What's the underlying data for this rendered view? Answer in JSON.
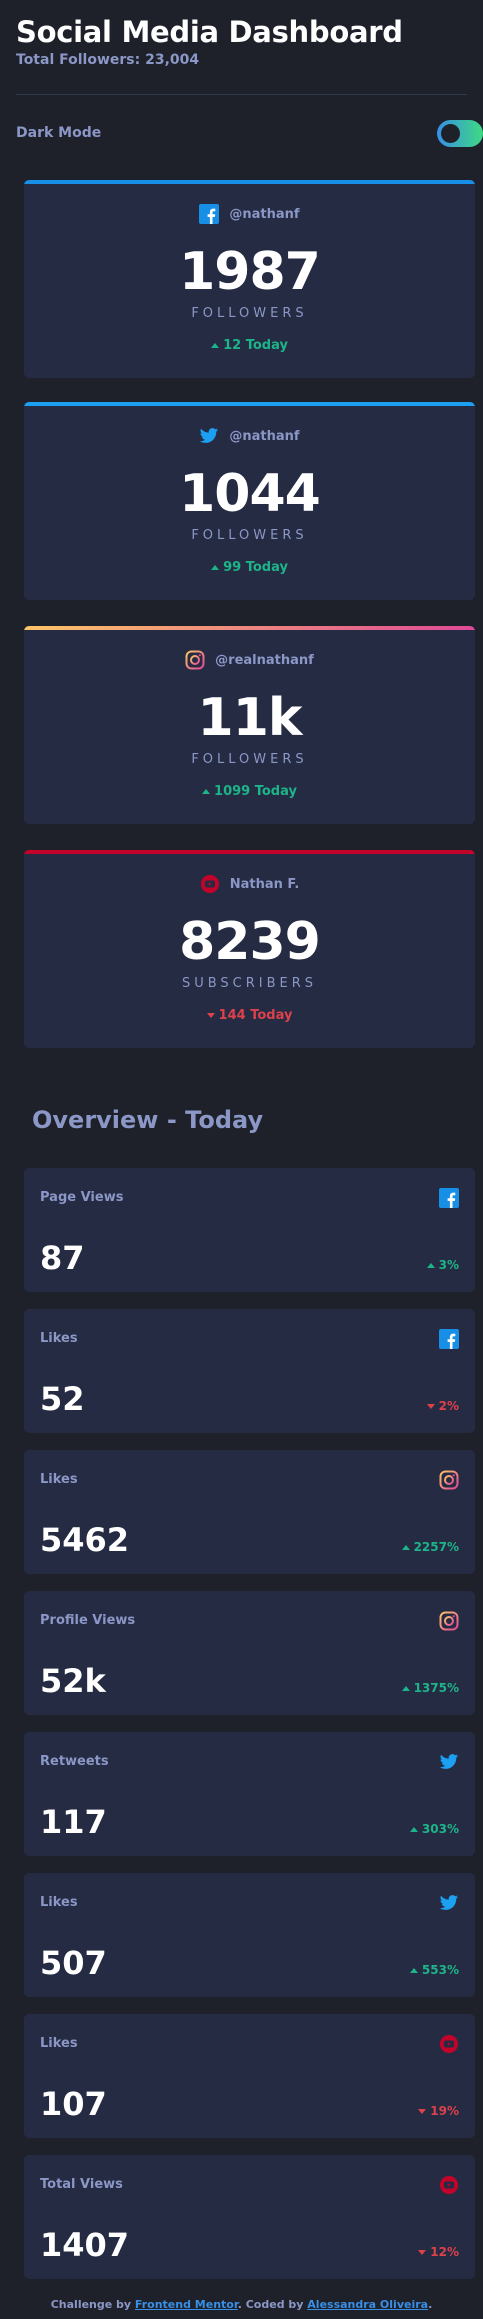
{
  "header": {
    "title": "Social Media Dashboard",
    "total_followers": "Total Followers: 23,004"
  },
  "mode": {
    "label": "Dark Mode",
    "enabled": true
  },
  "cards": [
    {
      "icon": "facebook-icon",
      "handle": "@nathanf",
      "count": "1987",
      "unit": "FOLLOWERS",
      "change": "12 Today",
      "direction": "up",
      "color": "#178fe6"
    },
    {
      "icon": "twitter-icon",
      "handle": "@nathanf",
      "count": "1044",
      "unit": "FOLLOWERS",
      "change": "99 Today",
      "direction": "up",
      "color": "#1ca0f2"
    },
    {
      "icon": "instagram-icon",
      "handle": "@realnathanf",
      "count": "11k",
      "unit": "FOLLOWERS",
      "change": "1099 Today",
      "direction": "up",
      "color": "#fdc468"
    },
    {
      "icon": "youtube-icon",
      "handle": "Nathan F.",
      "count": "8239",
      "unit": "SUBSCRIBERS",
      "change": "144 Today",
      "direction": "down",
      "color": "#c4032b"
    }
  ],
  "overview": {
    "title": "Overview - Today",
    "items": [
      {
        "label": "Page Views",
        "icon": "facebook-icon",
        "value": "87",
        "pct": "3%",
        "direction": "up"
      },
      {
        "label": "Likes",
        "icon": "facebook-icon",
        "value": "52",
        "pct": "2%",
        "direction": "down"
      },
      {
        "label": "Likes",
        "icon": "instagram-icon",
        "value": "5462",
        "pct": "2257%",
        "direction": "up"
      },
      {
        "label": "Profile Views",
        "icon": "instagram-icon",
        "value": "52k",
        "pct": "1375%",
        "direction": "up"
      },
      {
        "label": "Retweets",
        "icon": "twitter-icon",
        "value": "117",
        "pct": "303%",
        "direction": "up"
      },
      {
        "label": "Likes",
        "icon": "twitter-icon",
        "value": "507",
        "pct": "553%",
        "direction": "up"
      },
      {
        "label": "Likes",
        "icon": "youtube-icon",
        "value": "107",
        "pct": "19%",
        "direction": "down"
      },
      {
        "label": "Total Views",
        "icon": "youtube-icon",
        "value": "1407",
        "pct": "12%",
        "direction": "down"
      }
    ]
  },
  "footer": {
    "prefix": "Challenge by ",
    "link1": "Frontend Mentor",
    "middle": ". Coded by ",
    "link2": "Alessandra Oliveira",
    "suffix": "."
  },
  "colors": {
    "background": "#1e202a",
    "card": "#252b43",
    "text_muted": "#8b97c6",
    "up": "#1db489",
    "down": "#dc414c"
  }
}
